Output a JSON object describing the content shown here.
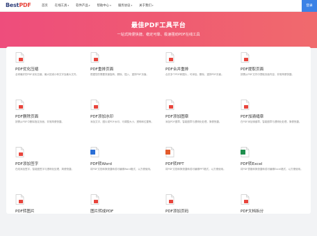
{
  "header": {
    "logo_prefix": "Best",
    "logo_suffix": "PDF",
    "nav": [
      {
        "label": "首页",
        "dropdown": false
      },
      {
        "label": "在线工具",
        "dropdown": true
      },
      {
        "label": "软件产品",
        "dropdown": true
      },
      {
        "label": "帮助中心",
        "dropdown": true
      },
      {
        "label": "服务协议",
        "dropdown": true
      },
      {
        "label": "关于我们",
        "dropdown": true
      }
    ],
    "login_label": "登录"
  },
  "hero": {
    "title": "最佳PDF工具平台",
    "subtitle": "一站式简便快捷、稳定可靠、极速强劲PDF在线工具"
  },
  "tools": [
    {
      "title": "PDF优化压缩",
      "desc": "全球最好的PDF优化压缩，最大拍减小转文字及最大文件。",
      "icon": "compress-icon",
      "color": "#e8453c"
    },
    {
      "title": "PDF重排页面",
      "desc": "根据您的需要快速旋转、删除、插入、重排PDF页面。",
      "icon": "reorder-icon",
      "color": "#e8453c"
    },
    {
      "title": "PDF合并重排",
      "desc": "合并多个PDF和图片，可添加、删除、重排PDF页面。",
      "icon": "merge-icon",
      "color": "#e8453c"
    },
    {
      "title": "PDF提取页面",
      "desc": "按需从PDF文件中提取页面内容，非常简便快捷。",
      "icon": "extract-icon",
      "color": "#e8453c"
    },
    {
      "title": "PDF删除页面",
      "desc": "按需从PDF中删除指定页面，非常简便快捷。",
      "icon": "delete-page-icon",
      "color": "#e8453c"
    },
    {
      "title": "PDF添加水印",
      "desc": "添加文字、图片或PDF水印，可调整大小、透明和位置等。",
      "icon": "watermark-icon",
      "color": "#e8453c"
    },
    {
      "title": "PDF添加图章",
      "desc": "添加PDF图章，智能图章与透明化处理，简便快捷。",
      "icon": "stamp-icon",
      "color": "#e8453c"
    },
    {
      "title": "PDF加骑缝章",
      "desc": "在PDF添加骑缝章，智能图章与透明化处理，简便快捷。",
      "icon": "seam-stamp-icon",
      "color": "#e8453c"
    },
    {
      "title": "PDF添加签字",
      "desc": "在线添加签字，智能图签字与透明化处理，简便快捷。",
      "icon": "signature-icon",
      "color": "#e8453c"
    },
    {
      "title": "PDF转Word",
      "desc": "将PDF文档转换快捷转成可编辑Word格式，以方便使用。",
      "icon": "word-icon",
      "color": "#2b6fd6"
    },
    {
      "title": "PDF转PPT",
      "desc": "将PDF文档转换快捷转成可编辑PPT格式，以方便使用。",
      "icon": "ppt-icon",
      "color": "#e25b2c"
    },
    {
      "title": "PDF转Excel",
      "desc": "将PDF表格转换快捷转成可编辑Excel格式，以方便使用。",
      "icon": "excel-icon",
      "color": "#1f8f4e"
    },
    {
      "title": "PDF转图片",
      "desc": "",
      "icon": "pdf-to-image-icon",
      "color": "#e8453c"
    },
    {
      "title": "图片转成PDF",
      "desc": "",
      "icon": "image-to-pdf-icon",
      "color": "#e8453c"
    },
    {
      "title": "PDF添加页码",
      "desc": "",
      "icon": "page-number-icon",
      "color": "#e8453c"
    },
    {
      "title": "PDF文档拆分",
      "desc": "",
      "icon": "split-icon",
      "color": "#e8453c"
    }
  ]
}
